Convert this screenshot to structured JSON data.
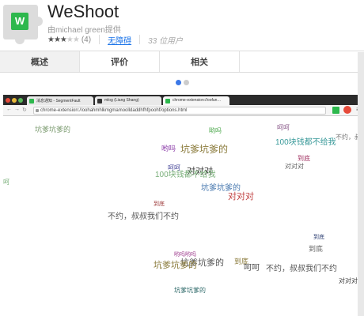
{
  "app": {
    "title": "WeShoot",
    "author": "由michael green提供",
    "icon_letter": "W",
    "stars_filled": 2.5,
    "stars_text_on": "★★★",
    "stars_text_off": "★★",
    "rating_count": "(4)",
    "free_label": "无障碍",
    "users": "33 位用户"
  },
  "tabs": [
    {
      "label": "概述",
      "active": true
    },
    {
      "label": "评价",
      "active": false
    },
    {
      "label": "相关",
      "active": false
    }
  ],
  "carousel": {
    "count": 2,
    "active_index": 0
  },
  "screenshot": {
    "browser_tabs": [
      {
        "label": "消息通知 - SegmentFault",
        "icon_color": "#2db84d"
      },
      {
        "label": "mlog (Liang Shang)",
        "icon_color": "#333333"
      },
      {
        "label": "chrome-extension://oofun…",
        "icon_color": "#2db84d"
      }
    ],
    "url": "chrome-extension://oohahmhlkmgmamoolldaddhfhfpoohf/options.html",
    "danmaku": [
      {
        "text": "坑爹坑爹的",
        "color": "#7a9a6e",
        "size": 9
      },
      {
        "text": "哟吗",
        "color": "#4ca84c",
        "size": 8
      },
      {
        "text": "呵呵",
        "color": "#8a5a8a",
        "size": 8
      },
      {
        "text": "不约，叔叔我们",
        "color": "#777777",
        "size": 8
      },
      {
        "text": "到底",
        "color": "#a03060",
        "size": 8
      },
      {
        "text": "哟吗",
        "color": "#8a3aa8",
        "size": 9
      },
      {
        "text": "坑爹坑爹的",
        "color": "#8a7a3a",
        "size": 12
      },
      {
        "text": "100块钱都不给我",
        "color": "#3a9a9a",
        "size": 10
      },
      {
        "text": "到底",
        "color": "#333333",
        "size": 9
      },
      {
        "text": "对对对",
        "color": "#666666",
        "size": 8
      },
      {
        "text": "呵呵",
        "color": "#4a4a9a",
        "size": 8
      },
      {
        "text": "对对对",
        "color": "#333333",
        "size": 11
      },
      {
        "text": "100块钱都不给我",
        "color": "#7ab07a",
        "size": 10
      },
      {
        "text": "坑爹坑爹的",
        "color": "#4a7ab0",
        "size": 10
      },
      {
        "text": "对对对",
        "color": "#c04040",
        "size": 11
      },
      {
        "text": "到底",
        "color": "#a04040",
        "size": 7
      },
      {
        "text": "不约，叔叔我们不约",
        "color": "#555555",
        "size": 10
      },
      {
        "text": "到底",
        "color": "#334477",
        "size": 7
      },
      {
        "text": "到底",
        "color": "#666666",
        "size": 9
      },
      {
        "text": "哟吗哟吗",
        "color": "#a04090",
        "size": 7
      },
      {
        "text": "坑爹坑爹的",
        "color": "#555555",
        "size": 11
      },
      {
        "text": "坑爹坑爹的",
        "color": "#8a7a3a",
        "size": 11
      },
      {
        "text": "到底",
        "color": "#8a7a3a",
        "size": 9
      },
      {
        "text": "呵呵",
        "color": "#555555",
        "size": 10
      },
      {
        "text": "不约，叔叔我们不约",
        "color": "#555555",
        "size": 10
      },
      {
        "text": "对对对",
        "color": "#444444",
        "size": 8
      },
      {
        "text": "坑爹坑爹的",
        "color": "#2f6a6a",
        "size": 8
      },
      {
        "text": "呵",
        "color": "#7ab07a",
        "size": 8
      }
    ]
  }
}
